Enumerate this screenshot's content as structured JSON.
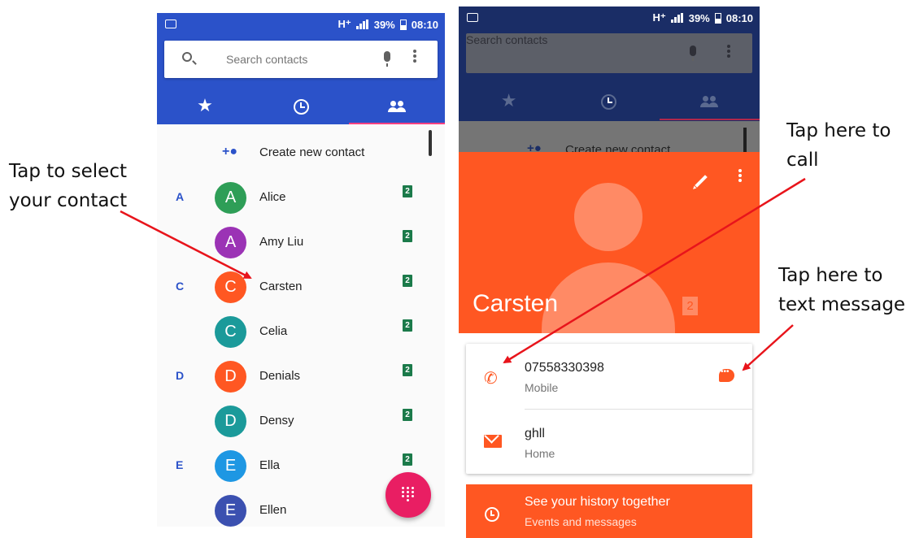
{
  "left_phone": {
    "status": {
      "network": "H⁺",
      "battery": "39%",
      "time": "08:10"
    },
    "search": {
      "placeholder": "Search contacts"
    },
    "tabs": [
      "favorites-tab",
      "recents-tab",
      "contacts-tab"
    ],
    "create_contact": {
      "label": "Create new contact"
    },
    "contacts": [
      {
        "section": "A",
        "initial": "A",
        "name": "Alice",
        "color": "#2e9e57",
        "sim": "2"
      },
      {
        "section": "",
        "initial": "A",
        "name": "Amy Liu",
        "color": "#9b33b5",
        "sim": "2"
      },
      {
        "section": "C",
        "initial": "C",
        "name": "Carsten",
        "color": "#ff5722",
        "sim": "2"
      },
      {
        "section": "",
        "initial": "C",
        "name": "Celia",
        "color": "#1b9a9a",
        "sim": "2"
      },
      {
        "section": "D",
        "initial": "D",
        "name": "Denials",
        "color": "#ff5722",
        "sim": "2"
      },
      {
        "section": "",
        "initial": "D",
        "name": "Densy",
        "color": "#1b9a9a",
        "sim": "2"
      },
      {
        "section": "E",
        "initial": "E",
        "name": "Ella",
        "color": "#1e97e3",
        "sim": "2"
      },
      {
        "section": "",
        "initial": "E",
        "name": "Ellen",
        "color": "#3b50b0",
        "sim": ""
      }
    ]
  },
  "right_phone": {
    "status": {
      "network": "H⁺",
      "battery": "39%",
      "time": "08:10"
    },
    "search": {
      "placeholder": "Search contacts"
    },
    "create_contact": {
      "label": "Create new contact"
    },
    "contact": {
      "name": "Carsten",
      "sim": "2",
      "phone": "07558330398",
      "phone_type": "Mobile",
      "email": "ghll",
      "email_type": "Home"
    },
    "history": {
      "title": "See your history together",
      "subtitle": "Events and messages"
    }
  },
  "annotations": {
    "select": [
      "Tap to select",
      "your contact"
    ],
    "call": [
      "Tap here to",
      "call"
    ],
    "text": [
      "Tap here to",
      "text message"
    ]
  },
  "colors": {
    "blue_header": "#2b52c9",
    "orange": "#ff5722",
    "fab": "#e91e63",
    "arrow": "#e8141b"
  }
}
